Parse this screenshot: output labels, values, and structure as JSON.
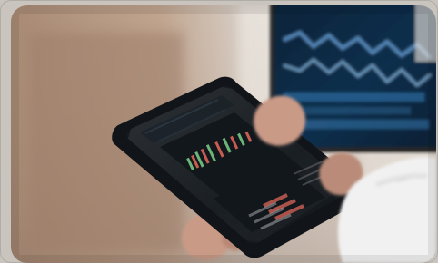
{
  "photo": {
    "kind": "stock-trading-photo",
    "palette": {
      "wall_warm": "#b79d86",
      "wall_light": "#e7e0d8",
      "monitor_bg": "#0d2a44",
      "monitor_accent": "#5a8fc2",
      "tablet_bezel": "#111418",
      "tablet_screen": "#151a1f",
      "candle_green": "#7bd08a",
      "candle_red": "#e56a5b",
      "skin": "#c99a86",
      "sleeve": "#f1f1f1"
    }
  }
}
